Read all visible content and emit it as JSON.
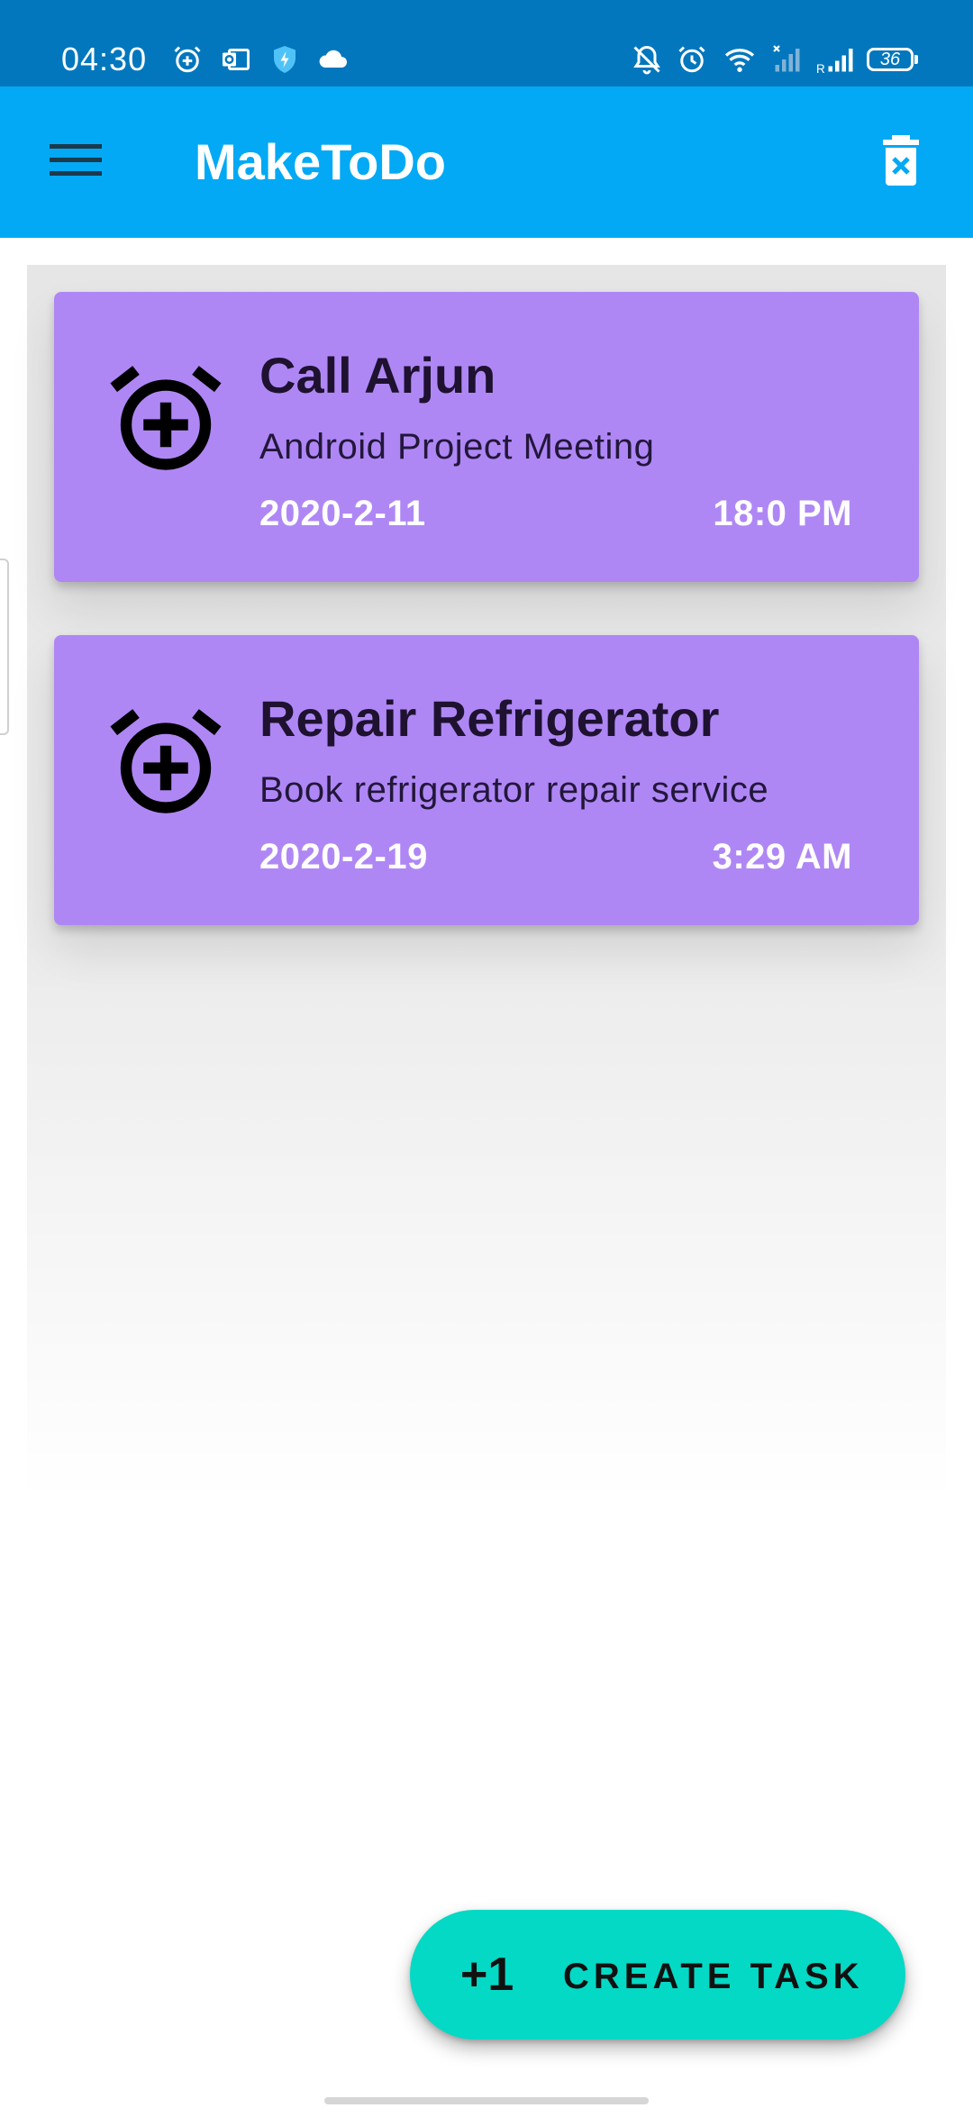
{
  "status_bar": {
    "time": "04:30",
    "battery": "36",
    "left_icons": [
      "alarm-plus-icon",
      "outlook-icon",
      "shield-bolt-icon",
      "cloud-icon"
    ],
    "right_icons": [
      "bell-off-icon",
      "alarm-icon",
      "wifi-icon",
      "signal-empty-icon",
      "signal-roaming-icon",
      "battery-icon"
    ],
    "background_color": "#0277bd"
  },
  "app_bar": {
    "title": "MakeToDo",
    "menu_icon": "hamburger-menu-icon",
    "action_icon": "delete-sweep-icon",
    "background_color": "#03a9f4"
  },
  "tasks": [
    {
      "title": "Call Arjun",
      "description": "Android Project Meeting",
      "date": "2020-2-11",
      "time": "18:0 PM",
      "icon": "alarm-add-icon"
    },
    {
      "title": "Repair Refrigerator",
      "description": "Book refrigerator repair service",
      "date": "2020-2-19",
      "time": "3:29 AM",
      "icon": "alarm-add-icon"
    }
  ],
  "fab": {
    "icon_text": "+1",
    "label": "CREATE TASK",
    "background_color": "#03d9c5"
  },
  "colors": {
    "card_background": "#af87f5",
    "card_title": "#1e1230",
    "card_meta": "#ffffff"
  }
}
